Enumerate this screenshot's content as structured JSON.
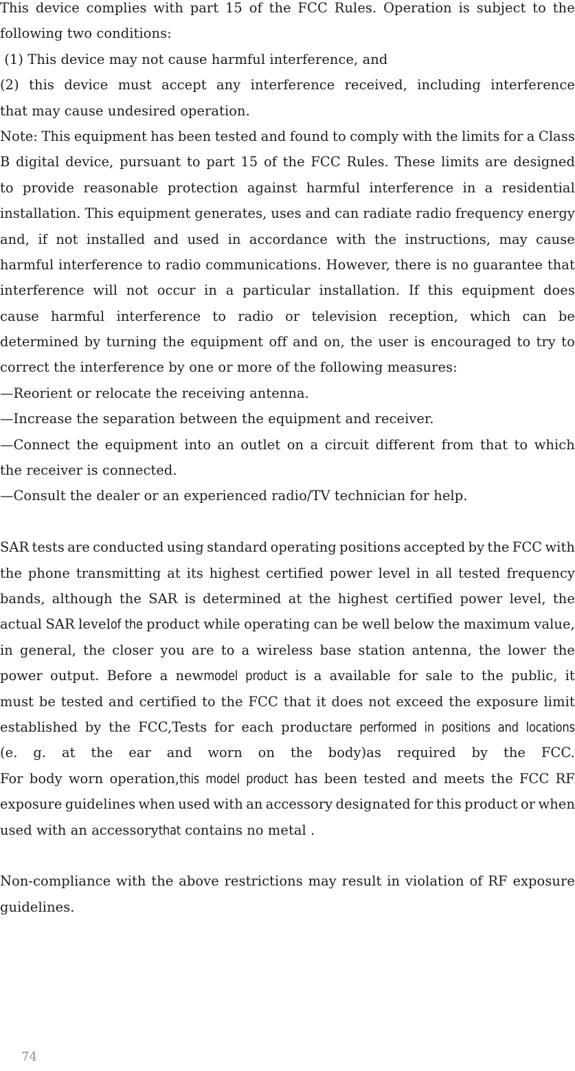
{
  "document": {
    "page_number": "74",
    "sections": [
      {
        "id": "fcc-conditions",
        "lines": [
          {
            "text": "This device complies with part 15 of the FCC Rules. Operation is subject to the",
            "align": "justify"
          },
          {
            "text": "following two conditions:",
            "align": "flush"
          },
          {
            "text": " (1) This device may not cause harmful interference, and",
            "align": "flush"
          },
          {
            "text": " (2) this device must accept any interference received, including  interference",
            "align": "justify"
          },
          {
            "text": "that may cause undesired operation.",
            "align": "flush"
          }
        ]
      },
      {
        "id": "fcc-note",
        "lines": [
          {
            "text": "Note: This equipment has been tested and found to comply with the limits for a Class",
            "align": "justify"
          },
          {
            "text": "B digital device, pursuant to  part 15 of the FCC Rules. These limits are designed",
            "align": "justify"
          },
          {
            "text": "to provide reasonable protection against harmful interference in  a residential",
            "align": "justify"
          },
          {
            "text": "installation. This equipment generates, uses and can radiate radio frequency energy",
            "align": "justify"
          },
          {
            "text": "and, if not installed  and used in accordance with the instructions, may cause",
            "align": "justify"
          },
          {
            "text": "harmful interference to radio communications. However,  there is no guarantee that",
            "align": "justify"
          },
          {
            "text": "interference will not occur in a particular installation. If this equipment does",
            "align": "justify"
          },
          {
            "text": "cause harmful  interference to radio or television reception, which can be",
            "align": "justify"
          },
          {
            "text": "determined by turning the equipment off and on, the user is  encouraged to try to",
            "align": "justify"
          },
          {
            "text": "correct the interference by one or more of the following measures:",
            "align": "flush"
          }
        ]
      },
      {
        "id": "fcc-measures",
        "lines": [
          {
            "text": "—Reorient or relocate the receiving antenna.",
            "align": "flush"
          },
          {
            "text": "—Increase the separation between the equipment and receiver.",
            "align": "flush"
          },
          {
            "text": "—Connect the equipment into an outlet on a circuit different from that to which",
            "align": "justify"
          },
          {
            "text": "the receiver is connected.",
            "align": "flush"
          },
          {
            "text": "—Consult the dealer or an experienced radio/TV technician for help.",
            "align": "flush"
          }
        ]
      },
      {
        "id": "sar-statement",
        "lines": [
          {
            "align": "justify",
            "runs": [
              {
                "text": "SAR tests are conducted using standard operating positions accepted by the FCC with",
                "style": "normal"
              }
            ]
          },
          {
            "align": "justify",
            "runs": [
              {
                "text": "the phone transmitting at its highest certified power level in all tested frequency",
                "style": "normal"
              }
            ]
          },
          {
            "align": "justify",
            "runs": [
              {
                "text": "bands, although the SAR is determined at the highest certified power level, the",
                "style": "normal"
              }
            ]
          },
          {
            "align": "justify",
            "runs": [
              {
                "text": "actual SAR level",
                "style": "normal"
              },
              {
                "text": "of the",
                "style": "alt"
              },
              {
                "text": " product while operating can be well below the maximum value,",
                "style": "normal"
              }
            ]
          },
          {
            "align": "justify",
            "runs": [
              {
                "text": "in general, the closer you are to a wireless base station antenna, the lower the",
                "style": "normal"
              }
            ]
          },
          {
            "align": "justify",
            "runs": [
              {
                "text": "power output. Before a new ",
                "style": "normal"
              },
              {
                "text": "model product",
                "style": "alt"
              },
              {
                "text": " is a available for sale to the public, it",
                "style": "normal"
              }
            ]
          },
          {
            "align": "justify",
            "runs": [
              {
                "text": "must be tested and certified to the FCC that it does not exceed the exposure limit",
                "style": "normal"
              }
            ]
          },
          {
            "align": "justify",
            "runs": [
              {
                "text": "established by the FCC,Tests for each product ",
                "style": "normal"
              },
              {
                "text": "are performed in positions and locations",
                "style": "alt"
              }
            ]
          },
          {
            "align": "justify",
            "runs": [
              {
                "text": "(e. g. at the ear and worn on the body)as required by the FCC.",
                "style": "normal"
              }
            ]
          },
          {
            "align": "justify",
            "runs": [
              {
                "text": "For body worn operation,",
                "style": "normal"
              },
              {
                "text": "this model product",
                "style": "alt"
              },
              {
                "text": " has been tested and meets the FCC RF",
                "style": "normal"
              }
            ]
          },
          {
            "align": "justify",
            "runs": [
              {
                "text": "exposure guidelines when used with an accessory designated for this product or when",
                "style": "normal"
              }
            ]
          },
          {
            "align": "flush",
            "runs": [
              {
                "text": "used with an accessory",
                "style": "normal"
              },
              {
                "text": "that",
                "style": "alt"
              },
              {
                "text": " contains no metal .",
                "style": "normal"
              }
            ]
          }
        ]
      },
      {
        "id": "non-compliance",
        "lines": [
          {
            "text": " Non-compliance with the above restrictions may result in violation of RF exposure",
            "align": "justify"
          },
          {
            "text": "guidelines.",
            "align": "flush"
          }
        ]
      }
    ]
  },
  "colors": {
    "text": "#1c1c1c",
    "page_number": "#8d8d8d",
    "background": "#ffffff"
  }
}
